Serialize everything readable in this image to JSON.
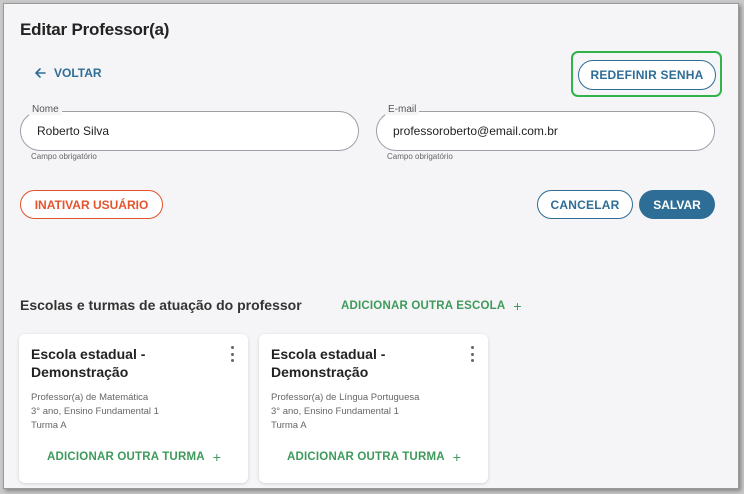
{
  "page": {
    "title": "Editar Professor(a)"
  },
  "nav": {
    "back_label": "VOLTAR"
  },
  "actions": {
    "reset_password_label": "REDEFINIR SENHA",
    "deactivate_label": "INATIVAR USUÁRIO",
    "cancel_label": "CANCELAR",
    "save_label": "SALVAR"
  },
  "form": {
    "name": {
      "label": "Nome",
      "value": "Roberto Silva",
      "helper": "Campo obrigatório"
    },
    "email": {
      "label": "E-mail",
      "value": "professoroberto@email.com.br",
      "helper": "Campo obrigatório"
    }
  },
  "schools_section": {
    "title": "Escolas e turmas de atuação do professor",
    "add_school_label": "ADICIONAR OUTRA ESCOLA",
    "cards": [
      {
        "school": "Escola estadual - Demonstração",
        "role": "Professor(a) de Matemática",
        "grade": "3° ano, Ensino Fundamental 1",
        "class": "Turma A",
        "add_class_label": "ADICIONAR OUTRA TURMA"
      },
      {
        "school": "Escola estadual - Demonstração",
        "role": "Professor(a) de Língua Portuguesa",
        "grade": "3° ano, Ensino Fundamental 1",
        "class": "Turma A",
        "add_class_label": "ADICIONAR OUTRA TURMA"
      }
    ]
  },
  "colors": {
    "primary": "#2e6d96",
    "danger": "#e3542e",
    "accent_green": "#3e9a5a",
    "highlight": "#2fb34a"
  },
  "icons": {
    "back": "arrow-left-icon",
    "plus": "plus-icon",
    "menu": "more-vertical-icon"
  }
}
